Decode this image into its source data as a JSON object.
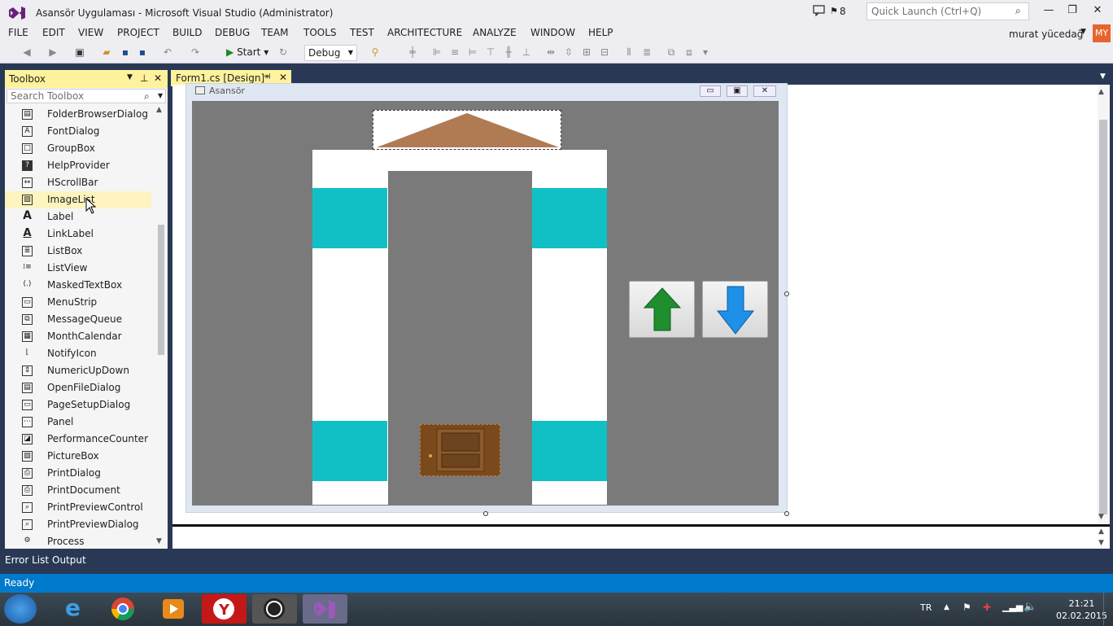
{
  "window": {
    "title": "Asansör Uygulaması - Microsoft Visual Studio (Administrator)",
    "notification_count": "8",
    "quick_launch_placeholder": "Quick Launch (Ctrl+Q)",
    "minimize": "—",
    "restore": "❐",
    "close": "✕"
  },
  "menu": {
    "items": [
      "FILE",
      "EDIT",
      "VIEW",
      "PROJECT",
      "BUILD",
      "DEBUG",
      "TEAM",
      "TOOLS",
      "TEST",
      "ARCHITECTURE",
      "ANALYZE",
      "WINDOW",
      "HELP"
    ],
    "user": "murat yücedağ",
    "avatar": "MY"
  },
  "toolbar": {
    "start_label": "Start",
    "config_value": "Debug"
  },
  "toolbox": {
    "title": "Toolbox",
    "search_placeholder": "Search Toolbox",
    "items": [
      "FolderBrowserDialog",
      "FontDialog",
      "GroupBox",
      "HelpProvider",
      "HScrollBar",
      "ImageList",
      "Label",
      "LinkLabel",
      "ListBox",
      "ListView",
      "MaskedTextBox",
      "MenuStrip",
      "MessageQueue",
      "MonthCalendar",
      "NotifyIcon",
      "NumericUpDown",
      "OpenFileDialog",
      "PageSetupDialog",
      "Panel",
      "PerformanceCounter",
      "PictureBox",
      "PrintDialog",
      "PrintDocument",
      "PrintPreviewControl",
      "PrintPreviewDialog",
      "Process"
    ],
    "selected_item": "ImageList"
  },
  "document": {
    "tab_label": "Form1.cs [Design]*",
    "form_title": "Asansör"
  },
  "bottom_tabs": [
    "Error List",
    "Output"
  ],
  "status": "Ready",
  "taskbar": {
    "language": "TR",
    "time": "21:21",
    "date": "02.02.2015"
  },
  "colors": {
    "vs_purple": "#68217a",
    "accent_blue": "#007acc",
    "shaft_cyan": "#11c0c4",
    "roof_brown": "#b07a52"
  }
}
